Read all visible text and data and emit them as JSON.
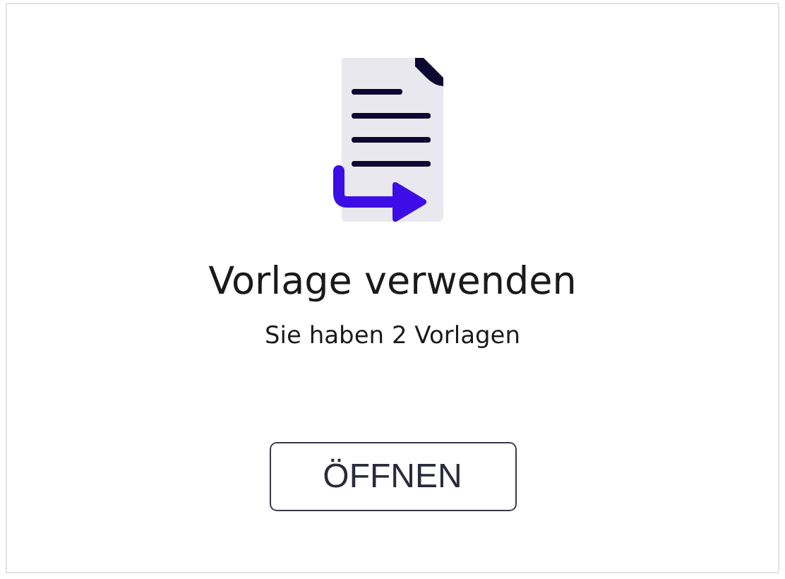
{
  "card": {
    "title": "Vorlage verwenden",
    "subtitle": "Sie haben 2 Vorlagen",
    "button": "ÖFFNEN"
  }
}
